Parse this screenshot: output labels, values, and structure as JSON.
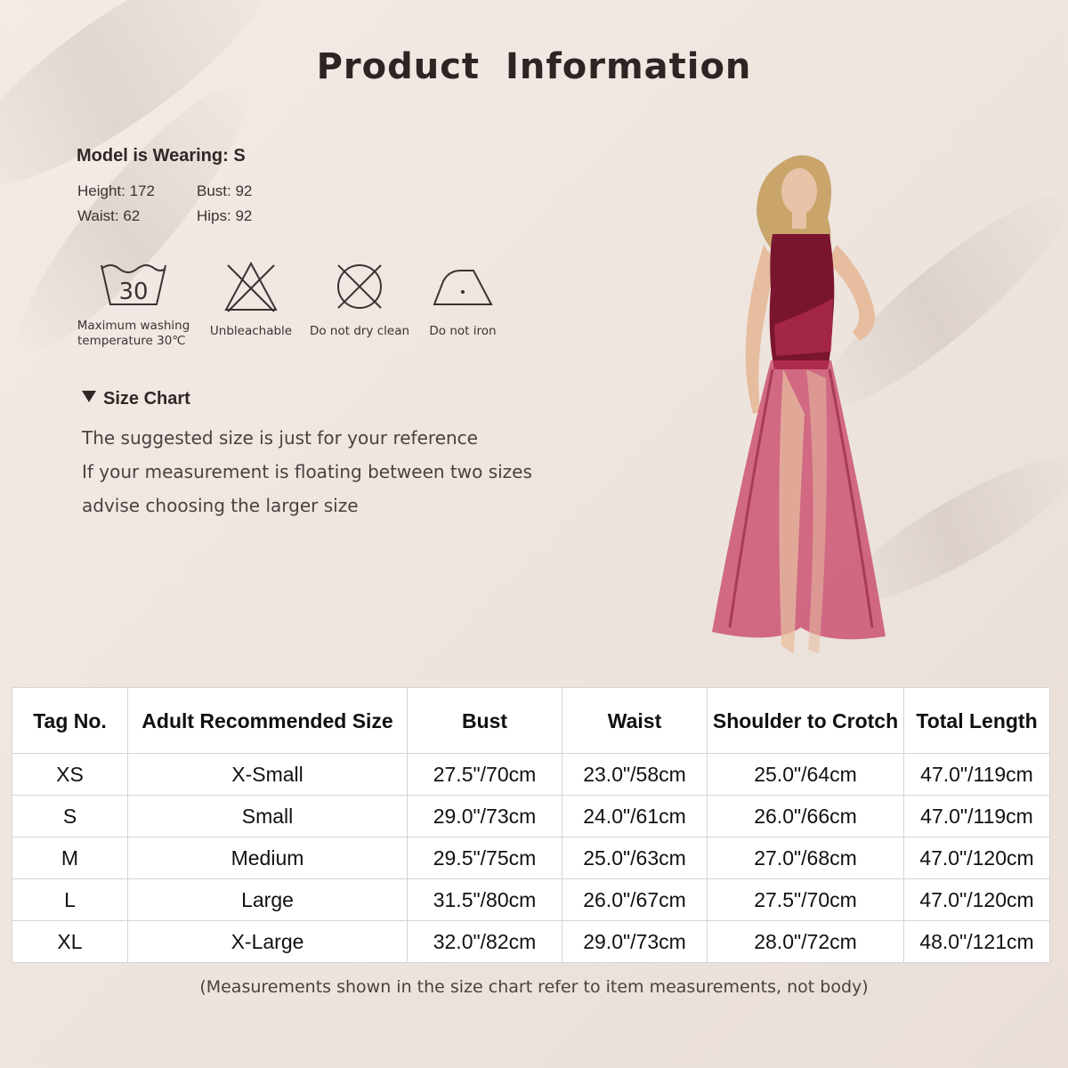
{
  "title": "Product  Information",
  "model": {
    "heading": "Model is Wearing: S",
    "height": "Height: 172",
    "bust": "Bust: 92",
    "waist": "Waist: 62",
    "hips": "Hips: 92"
  },
  "care": [
    {
      "icon": "wash-30-icon",
      "number": "30",
      "label_line1": "Maximum washing",
      "label_line2": "temperature 30℃"
    },
    {
      "icon": "no-bleach-icon",
      "label_line1": "Unbleachable"
    },
    {
      "icon": "no-dry-clean-icon",
      "label_line1": "Do not dry clean"
    },
    {
      "icon": "no-iron-icon",
      "label_line1": "Do not iron"
    }
  ],
  "size_chart": {
    "heading": "Size Chart",
    "notes": [
      "The suggested size is just for your reference",
      "If your measurement is floating between two sizes",
      "advise choosing the larger size"
    ]
  },
  "table": {
    "headers": [
      "Tag No.",
      "Adult Recommended Size",
      "Bust",
      "Waist",
      "Shoulder to Crotch",
      "Total Length"
    ],
    "rows": [
      [
        "XS",
        "X-Small",
        "27.5\"/70cm",
        "23.0\"/58cm",
        "25.0\"/64cm",
        "47.0\"/119cm"
      ],
      [
        "S",
        "Small",
        "29.0\"/73cm",
        "24.0\"/61cm",
        "26.0\"/66cm",
        "47.0\"/119cm"
      ],
      [
        "M",
        "Medium",
        "29.5\"/75cm",
        "25.0\"/63cm",
        "27.0\"/68cm",
        "47.0\"/120cm"
      ],
      [
        "L",
        "Large",
        "31.5\"/80cm",
        "26.0\"/67cm",
        "27.5\"/70cm",
        "47.0\"/120cm"
      ],
      [
        "XL",
        "X-Large",
        "32.0\"/82cm",
        "29.0\"/73cm",
        "28.0\"/72cm",
        "48.0\"/121cm"
      ]
    ]
  },
  "footnote": "(Measurements shown in the size chart refer to item measurements, not body)",
  "colors": {
    "background": "#efe6e0",
    "dress": "#7a1530",
    "skirt": "#c4355d",
    "text": "#3a3332"
  }
}
